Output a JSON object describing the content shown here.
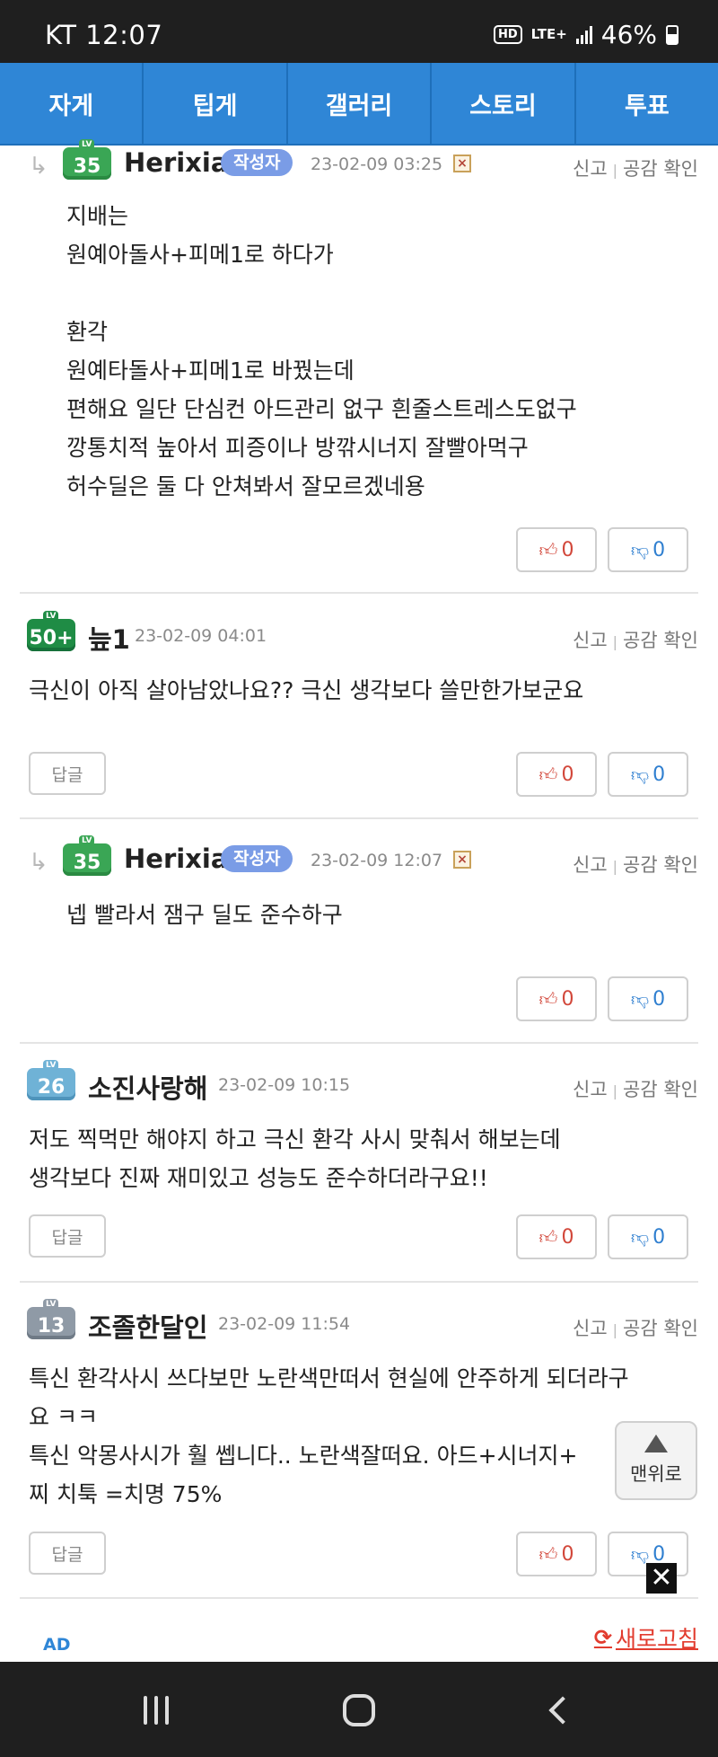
{
  "status_bar": {
    "carrier_time": "KT 12:07",
    "hd": "HD",
    "lte": "LTE+",
    "battery": "46%"
  },
  "tabs": [
    {
      "label": "자게"
    },
    {
      "label": "팁게"
    },
    {
      "label": "갤러리"
    },
    {
      "label": "스토리"
    },
    {
      "label": "투표"
    }
  ],
  "actions": {
    "report": "신고",
    "empathy": "공감 확인",
    "reply": "답글",
    "author_badge": "작성자"
  },
  "comments": [
    {
      "level": "35",
      "nickname": "Herixia",
      "date": "23-02-09 03:25",
      "body": "지배는\n원예아돌사+피메1로 하다가\n\n환각\n원예타돌사+피메1로 바꿨는데\n편해요 일단 단심컨 아드관리 없구 흰줄스트레스도없구\n깡통치적 높아서 피증이나 방깎시너지 잘빨아먹구\n허수딜은 둘 다 안쳐봐서 잘모르겠네용",
      "up": "0",
      "down": "0"
    },
    {
      "level": "50+",
      "nickname": "늪1",
      "date": "23-02-09 04:01",
      "body": "극신이 아직 살아남았나요?? 극신 생각보다 쓸만한가보군요",
      "up": "0",
      "down": "0"
    },
    {
      "level": "35",
      "nickname": "Herixia",
      "date": "23-02-09 12:07",
      "body": "넵 빨라서 잼구 딜도 준수하구",
      "up": "0",
      "down": "0"
    },
    {
      "level": "26",
      "nickname": "소진사랑해",
      "date": "23-02-09 10:15",
      "body": "저도 찍먹만 해야지 하고 극신 환각 사시 맞춰서 해보는데\n생각보다 진짜 재미있고 성능도 준수하더라구요!!",
      "up": "0",
      "down": "0"
    },
    {
      "level": "13",
      "nickname": "조졸한달인",
      "date": "23-02-09 11:54",
      "body": "특신 환각사시 쓰다보만 노란색만떠서 현실에 안주하게 되더라구\n요 ㅋㅋ\n특신 악몽사시가 훨 쎕니다.. 노란색잘떠요. 아드+시너지+\n찌 치툭 =치명 75%",
      "up": "0",
      "down": "0"
    }
  ],
  "to_top_label": "맨위로",
  "ad_label": "AD",
  "refresh_label": "새로고침"
}
